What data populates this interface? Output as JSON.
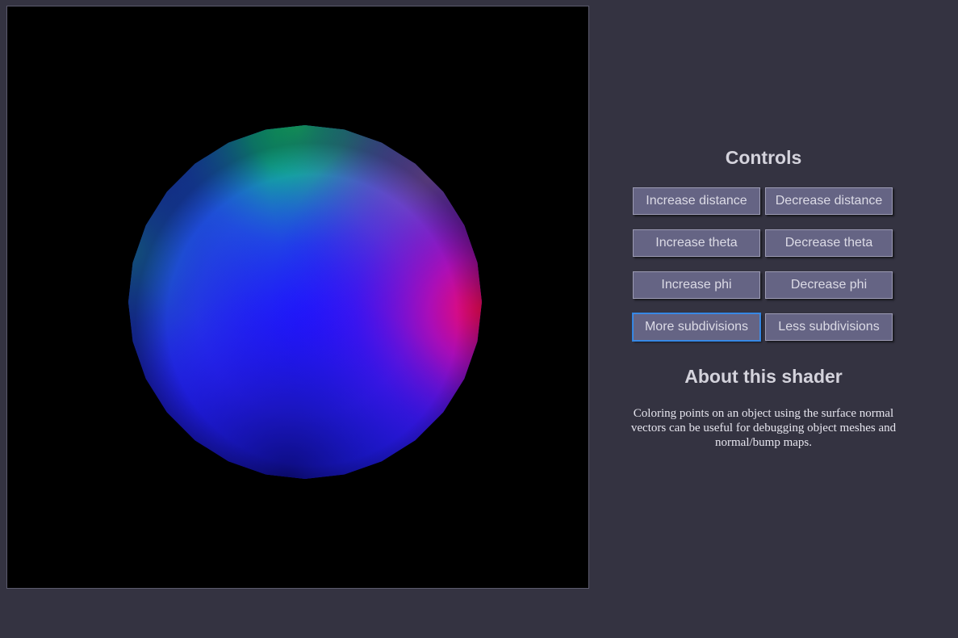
{
  "viewport": {
    "background_color": "#000000",
    "object": "sphere",
    "shading": "surface-normal-colors",
    "colors": {
      "top": "#19e57a",
      "center": "#1e14ff",
      "right": "#ff0a5a",
      "left": "#1a8fb0",
      "bottom": "#0e0a8a"
    }
  },
  "controls": {
    "heading": "Controls",
    "buttons": {
      "increase_distance": "Increase distance",
      "decrease_distance": "Decrease distance",
      "increase_theta": "Increase theta",
      "decrease_theta": "Decrease theta",
      "increase_phi": "Increase phi",
      "decrease_phi": "Decrease phi",
      "more_subdivisions": "More subdivisions",
      "less_subdivisions": "Less subdivisions"
    }
  },
  "about": {
    "heading": "About this shader",
    "text": "Coloring points on an object using the surface normal vectors can be useful for debugging object meshes and normal/bump maps."
  },
  "theme": {
    "page_background": "#343341",
    "button_background": "#656484",
    "button_text": "#dcdbe6",
    "focus_ring": "#3b8de8"
  }
}
